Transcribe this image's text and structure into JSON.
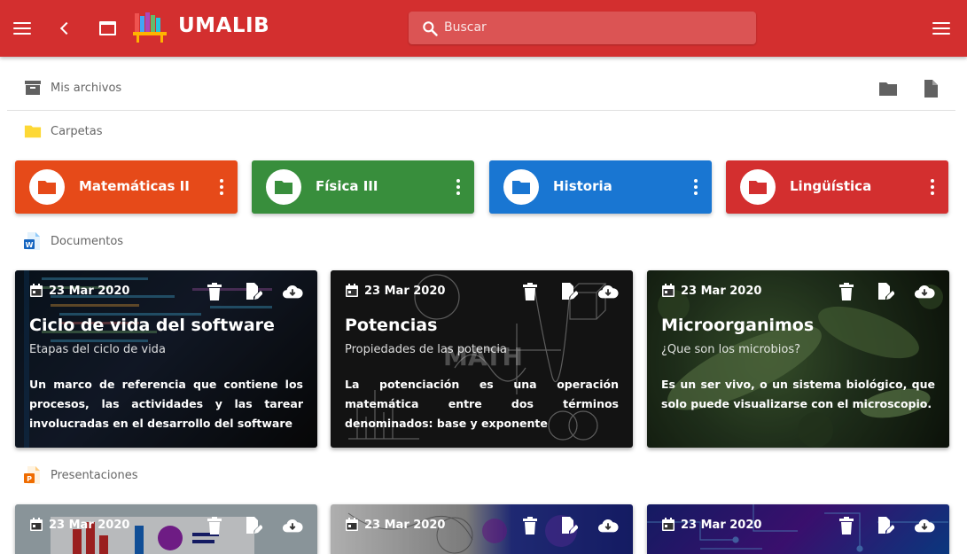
{
  "app": {
    "name": "UMALIB"
  },
  "search": {
    "placeholder": "Buscar"
  },
  "sections": {
    "files": "Mis archivos",
    "folders": "Carpetas",
    "documents": "Documentos",
    "presentations": "Presentaciones"
  },
  "folders": [
    {
      "label": "Matemáticas II",
      "color": "#e64a19"
    },
    {
      "label": "Física III",
      "color": "#388e3c"
    },
    {
      "label": "Historia",
      "color": "#1976d2"
    },
    {
      "label": "Lingüística",
      "color": "#d32f2f"
    }
  ],
  "documents": [
    {
      "date": "23 Mar 2020",
      "title": "Ciclo de vida del software",
      "subtitle": "Etapas del ciclo de vida",
      "description": "Un marco de referencia que contiene los procesos, las actividades y las tarear involucradas en el desarrollo del software"
    },
    {
      "date": "23 Mar 2020",
      "title": "Potencias",
      "subtitle": "Propiedades de las potencia",
      "description": "La potenciación es una operación matemática entre dos términos denominados: base y exponente"
    },
    {
      "date": "23 Mar 2020",
      "title": "Microorganimos",
      "subtitle": "¿Que son los microbios?",
      "description": "Es un ser vivo, o un sistema biológico, que solo puede visualizarse con el microscopio."
    }
  ],
  "presentations": [
    {
      "date": "23 Mar 2020"
    },
    {
      "date": "23 Mar 2020"
    },
    {
      "date": "23 Mar 2020"
    }
  ],
  "decor": {
    "math_board_text": "MATH"
  },
  "icons": {
    "menu": "menu-icon",
    "back": "chevron-left-icon",
    "window": "window-icon",
    "search": "search-icon",
    "archive": "archive-icon",
    "folder": "folder-icon",
    "file": "file-icon",
    "calendar": "calendar-icon",
    "delete": "trash-icon",
    "edit": "edit-icon",
    "download": "cloud-download-icon",
    "more": "kebab-icon"
  },
  "colors": {
    "primary": "#d32f2f",
    "folders_header": "#fbc02d",
    "word": "#1565c0",
    "powerpoint": "#ef6c00"
  }
}
